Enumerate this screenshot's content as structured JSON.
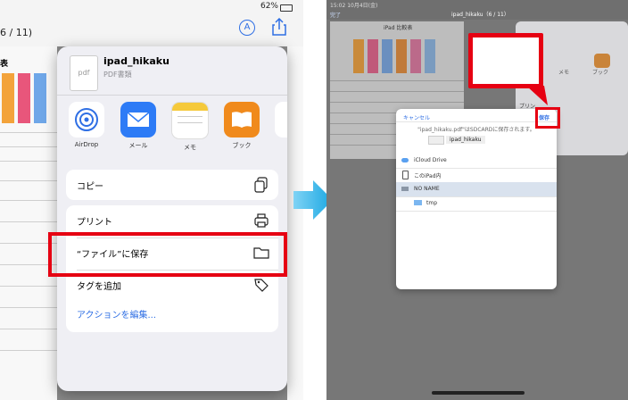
{
  "left": {
    "status": {
      "wifi_battery": "62%"
    },
    "page_indicator": "6 / 11)",
    "doc_heading": "表",
    "share": {
      "file_name": "ipad_hikaku",
      "file_type": "PDF書類",
      "file_icon_text": "pdf",
      "apps": [
        {
          "label": "AirDrop",
          "icon": "airdrop-icon",
          "color": "#ffffff"
        },
        {
          "label": "メール",
          "icon": "mail-icon",
          "color": "#2d7bf6"
        },
        {
          "label": "メモ",
          "icon": "notes-icon",
          "color": "#ffffff"
        },
        {
          "label": "ブック",
          "icon": "books-icon",
          "color": "#f08a1c"
        }
      ],
      "actions": [
        {
          "label": "コピー",
          "icon": "copy-icon"
        },
        {
          "label": "プリント",
          "icon": "print-icon"
        },
        {
          "label": "“ファイル”に保存",
          "icon": "folder-icon"
        },
        {
          "label": "タグを追加",
          "icon": "tag-icon"
        }
      ],
      "edit_actions_link": "アクションを編集..."
    }
  },
  "right": {
    "statusbar_time": "15:02 10月4日(金)",
    "title": "ipad_hikaku（6 / 11）",
    "nav_label": "完了",
    "doc_title": "iPad 比較表",
    "callout_text": "保存",
    "modal": {
      "cancel": "キャンセル",
      "save": "保存",
      "message": "\"ipad_hikaku.pdf\"はSDCARDに保存されます。",
      "filename": "ipad_hikaku",
      "locations": [
        {
          "label": "iCloud Drive",
          "icon": "cloud-icon"
        },
        {
          "label": "このiPad内",
          "icon": "ipad-icon"
        },
        {
          "label": "NO NAME",
          "icon": "drive-icon"
        },
        {
          "label": "tmp",
          "icon": "folder-icon"
        }
      ]
    },
    "side_menu": {
      "print_label": "プリン"
    },
    "app_labels": [
      "メモ",
      "ブック"
    ]
  },
  "accent": "#2f6fe4",
  "highlight": "#e60012"
}
